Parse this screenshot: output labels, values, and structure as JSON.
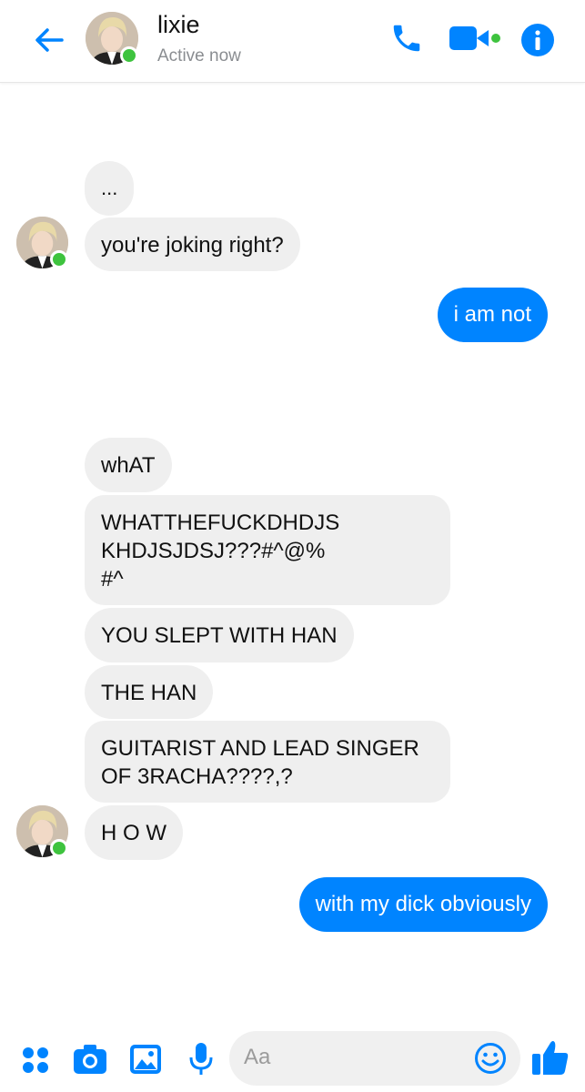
{
  "header": {
    "contact_name": "lixie",
    "status": "Active now",
    "colors": {
      "accent": "#0084ff",
      "presence": "#3ec33e"
    },
    "icons": [
      "back-arrow-icon",
      "phone-icon",
      "video-camera-icon",
      "info-icon"
    ]
  },
  "messages": [
    {
      "from": "them",
      "text": "..."
    },
    {
      "from": "them",
      "text": "you're joking right?"
    },
    {
      "from": "me",
      "text": "i am not"
    },
    {
      "from": "them",
      "text": "whAT"
    },
    {
      "from": "them",
      "text": "WHATTHEFUCKDHDJS\nKHDJSJDSJ???#^@%\n#^"
    },
    {
      "from": "them",
      "text": "YOU SLEPT WITH HAN"
    },
    {
      "from": "them",
      "text": "THE HAN"
    },
    {
      "from": "them",
      "text": "GUITARIST AND LEAD SINGER\nOF 3RACHA????,?"
    },
    {
      "from": "them",
      "text": "H O W"
    },
    {
      "from": "me",
      "text": "with my dick obviously"
    }
  ],
  "composer": {
    "placeholder": "Aa",
    "icons": [
      "apps-icon",
      "camera-icon",
      "image-icon",
      "microphone-icon",
      "emoji-icon",
      "thumbs-up-icon"
    ]
  }
}
